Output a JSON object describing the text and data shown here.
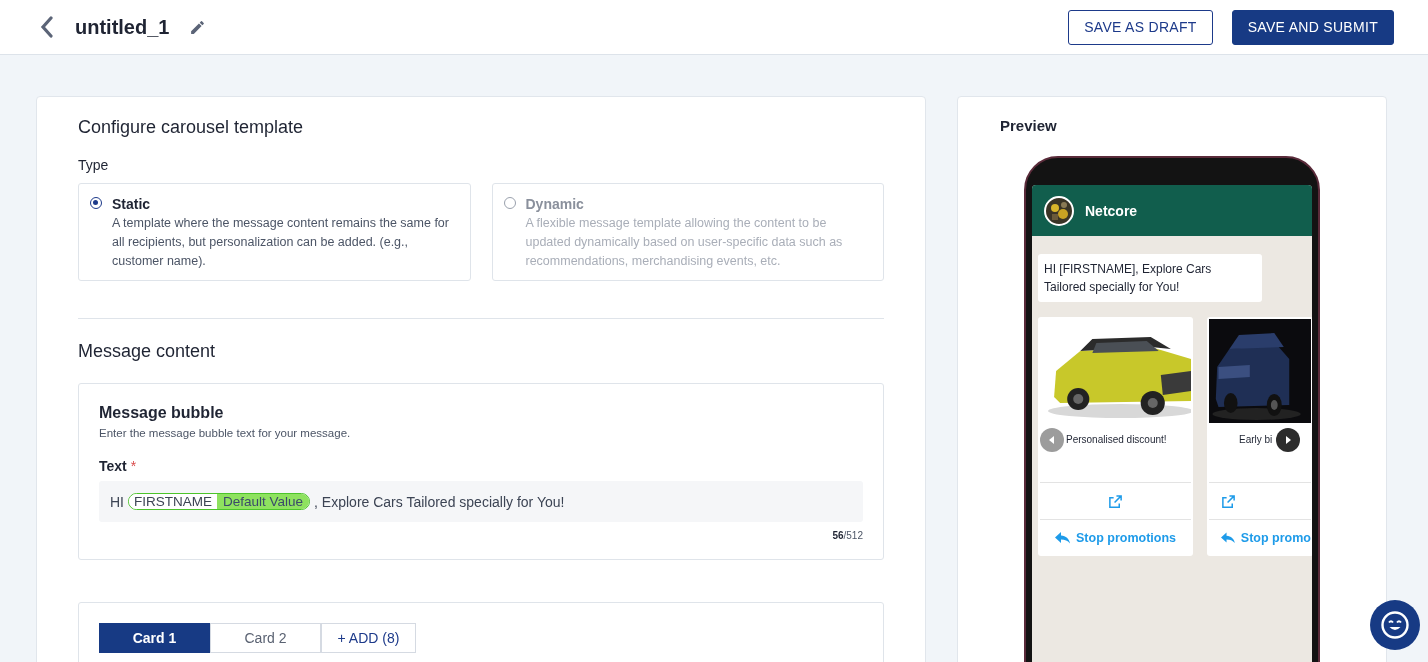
{
  "header": {
    "title": "untitled_1",
    "buttons": [
      {
        "label": "SAVE AS DRAFT",
        "kind": "outline"
      },
      {
        "label": "SAVE AND SUBMIT",
        "kind": "primary"
      }
    ]
  },
  "configure": {
    "title": "Configure carousel template",
    "type_label": "Type",
    "options": [
      {
        "title": "Static",
        "description": "A template where the message content remains the same for all recipients, but personalization can be added. (e.g., customer name).",
        "selected": true,
        "disabled": false
      },
      {
        "title": "Dynamic",
        "description": "A flexible message template allowing the content to be updated dynamically based on user-specific data such as recommendations, merchandising events, etc.",
        "selected": false,
        "disabled": true
      }
    ]
  },
  "message": {
    "title": "Message content",
    "bubble_title": "Message bubble",
    "bubble_description": "Enter the message bubble text for your message.",
    "text_label": "Text",
    "required_mark": "*",
    "parts": [
      {
        "kind": "text",
        "text": "HI"
      },
      {
        "kind": "variable",
        "name": "FIRSTNAME",
        "default": "Default Value"
      },
      {
        "kind": "text",
        "text": ", Explore Cars Tailored specially for You!"
      }
    ],
    "count": "56",
    "limit": "/512"
  },
  "card_tabs": [
    {
      "label": "Card 1",
      "selected": true
    },
    {
      "label": "Card 2",
      "selected": false
    }
  ],
  "add_button": "+ ADD (8)",
  "preview": {
    "title": "Preview",
    "contact": "Netcore",
    "bubble": "HI [FIRSTNAME], Explore Cars Tailored specially for You!",
    "cards": [
      {
        "caption": "Personalised discount!",
        "button": "Stop promotions",
        "nav": {
          "kind": "prev",
          "disabled": true
        }
      },
      {
        "caption": "Early bi",
        "button": "Stop promo",
        "nav": {
          "kind": "next",
          "disabled": false
        }
      }
    ]
  }
}
